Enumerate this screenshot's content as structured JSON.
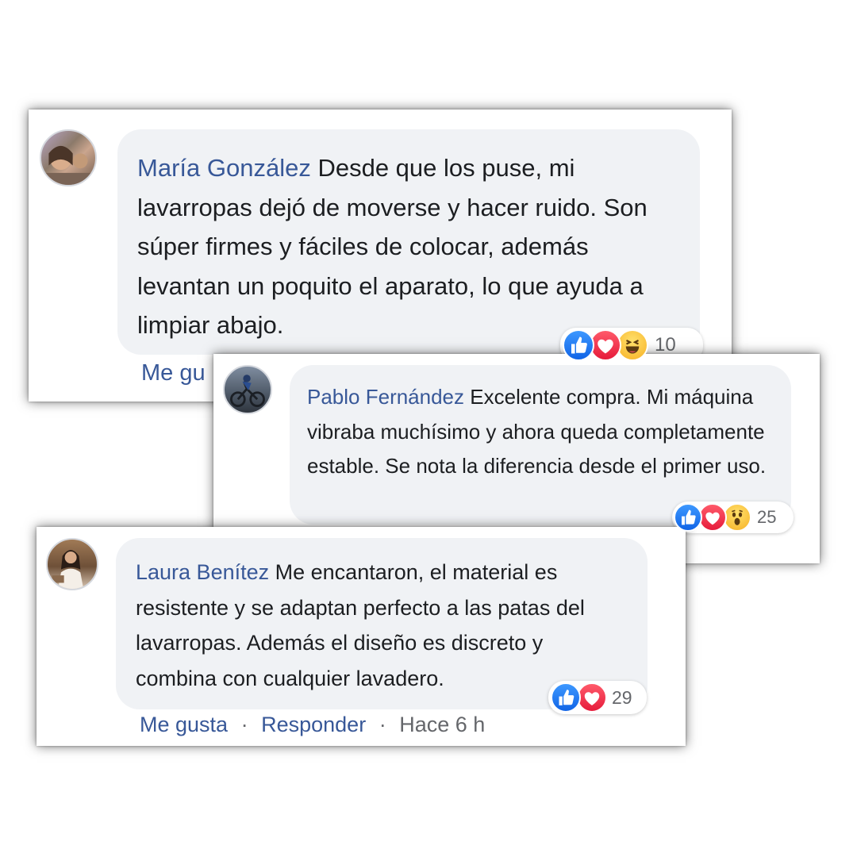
{
  "comments": [
    {
      "author": "María González",
      "text": "Desde que los puse, mi lavarropas dejó de moverse y hacer ruido. Son súper firmes y fáciles de colocar, además levantan un poquito el aparato, lo que ayuda a limpiar abajo.",
      "reactions": [
        "like-icon",
        "love-icon",
        "haha-icon"
      ],
      "reaction_count": "10",
      "like_label": "Me gu"
    },
    {
      "author": "Pablo Fernández",
      "text": "Excelente compra. Mi máquina vibraba muchísimo y ahora queda completamente estable. Se nota la diferencia desde el primer uso.",
      "reactions": [
        "like-icon",
        "love-icon",
        "wow-icon"
      ],
      "reaction_count": "25"
    },
    {
      "author": "Laura Benítez",
      "text": "Me encantaron, el material es resistente y se adaptan perfecto a las patas del lavarropas. Además el diseño es discreto y combina con cualquier lavadero.",
      "reactions": [
        "like-icon",
        "love-icon"
      ],
      "reaction_count": "29",
      "like_label": "Me gusta",
      "reply_label": "Responder",
      "separator": "·",
      "time": "Hace 6 h"
    }
  ],
  "colors": {
    "author": "#385898",
    "text": "#1c1e21",
    "bubble": "#f0f2f5",
    "muted": "#65676b",
    "like": "#1877f2",
    "love": "#f33e58",
    "haha_wow": "#f7b125"
  }
}
